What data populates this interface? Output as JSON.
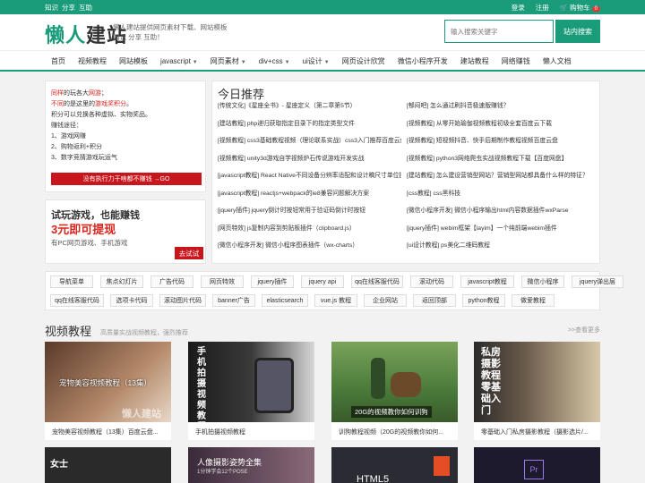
{
  "topbar": {
    "left": [
      "知识",
      "分享",
      "互助"
    ],
    "login": "登录",
    "register": "注册",
    "cart": "购物车",
    "cart_count": "0"
  },
  "header": {
    "logo_a": "懒人",
    "logo_b": "建站",
    "slogan_1": "懒人建站提供网页素材下载、网站模板",
    "slogan_2": "知识 分享 互助！",
    "search_placeholder": "输入搜索关键字",
    "search_button": "站内搜索"
  },
  "nav": [
    {
      "label": "首页",
      "dropdown": false
    },
    {
      "label": "视频教程",
      "dropdown": false
    },
    {
      "label": "网站模板",
      "dropdown": false
    },
    {
      "label": "javascript",
      "dropdown": true
    },
    {
      "label": "网页素材",
      "dropdown": true
    },
    {
      "label": "div+css",
      "dropdown": true
    },
    {
      "label": "ui设计",
      "dropdown": true
    },
    {
      "label": "网页设计欣赏",
      "dropdown": false
    },
    {
      "label": "微信小程序开发",
      "dropdown": false
    },
    {
      "label": "建站教程",
      "dropdown": false
    },
    {
      "label": "网络赚钱",
      "dropdown": false
    },
    {
      "label": "懒人文档",
      "dropdown": false
    }
  ],
  "promo1": {
    "l1a": "同样",
    "l1b": "的玩各大",
    "l1c": "网游",
    "l1d": "；",
    "l2a": "不同",
    "l2b": "的是这里的",
    "l2c": "游戏奖积分",
    "l2d": "。",
    "l3": "积分可以兑换各种虚拟、实物奖品。",
    "l4": "赚钱途径：",
    "steps": [
      "1、游戏网赚",
      "2、购物返利+积分",
      "3、数字竞猜游戏玩运气"
    ],
    "button": "没有执行力干啥都不赚钱 →GO"
  },
  "promo2": {
    "title": "试玩游戏，也能赚钱",
    "money": "3元即可提现",
    "desc": "有PC网页游戏、手机游戏",
    "button": "去试试"
  },
  "today": {
    "title": "今日推荐",
    "left": [
      "[传统文化]《星座全书》- 星座定义（第二章第5节）",
      "[建站教程] php递归获取指定目录下的指定类型文件",
      "[视频教程] css3基础教程视频（理论联系实战）css3入门推荐百度云盘",
      "[视频教程] unity3d游戏自学视频炉石传说游戏开发实战",
      "[javascript教程] React Native不同设备分辨率适配和设计稿尺寸单位换算",
      "[javascript教程] reactjs+webpack的ie8兼容问题解决方案",
      "[jquery插件] jquery倒计时按钮常用于验证码倒计时按钮",
      "[网页特效] js复制内容到剪贴板插件（clipboard.js）",
      "[微信小程序开发] 微信小程序图表插件（wx-charts）"
    ],
    "right": [
      "[郁闷吧] 怎么通过刷抖音极速版赚钱？",
      "[视频教程] 从零开始瑜伽视频教程初级全套百度云下载",
      "[视频教程] 短视频抖音、快手后期制作教程视频百度云盘",
      "[视频教程] python3网络爬虫实战视频教程下载【百度网盘】",
      "[建站教程] 怎么建设营销型网站？营销型网站都具备什么样的特征？",
      "[css教程] css黑科技",
      "[微信小程序开发] 微信小程序输出html内容数据插件wxParse",
      "[jquery插件] webim框架【layim】一个纯前端webim插件",
      "[ui设计教程] ps美化二维码教程"
    ]
  },
  "tags": [
    [
      "导航菜单",
      "焦点幻灯片",
      "广告代码",
      "网页特效",
      "jquery插件",
      "jquery api",
      "qq在线客服代码",
      "滚动代码",
      "javascript教程",
      "微信小程序",
      "jquery弹出层"
    ],
    [
      "qq在线客服代码",
      "选项卡代码",
      "滚动图片代码",
      "banner广告",
      "elasticsearch",
      "vue.js 教程",
      "企业网站",
      "返回顶部",
      "python教程",
      "做爱教程"
    ]
  ],
  "section": {
    "title": "视频教程",
    "subtitle": "高质量实战视频教程，强烈推荐",
    "more": ">>查看更多"
  },
  "cards": [
    {
      "img_text": "宠物美容视频教程（13集）",
      "watermark": "懒人建站",
      "caption": "宠物美容视频教程（13集）百度云盘..."
    },
    {
      "img_text": "手机拍摄视频教程",
      "caption": "手机拍摄视频教程"
    },
    {
      "img_text": "20G的视频教你如何训狗",
      "caption": "训狗教程视频（20G的视频教你如何..."
    },
    {
      "img_text": "私房摄影教程零基础入门",
      "caption": "零基础入门私房摄影教程（摄影选片/..."
    }
  ],
  "cards_row2": [
    {
      "img_text": "女士"
    },
    {
      "img_text": "人像摄影姿势全集",
      "img_sub": "1分钟学会12个POSE"
    },
    {
      "img_text": "HTML5"
    },
    {
      "img_text": "Pr"
    }
  ],
  "colors": {
    "brand": "#1a9b7a",
    "red": "#c8161d"
  }
}
